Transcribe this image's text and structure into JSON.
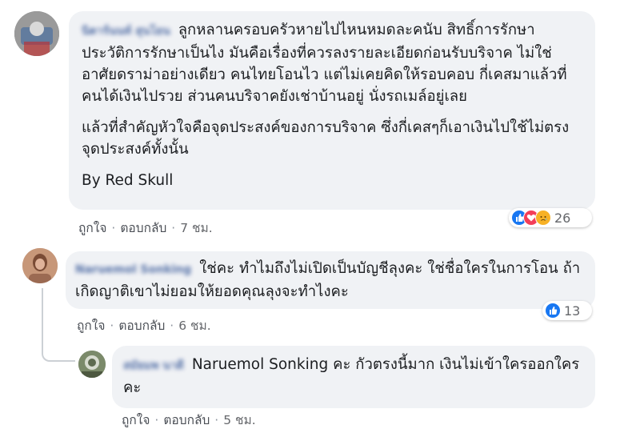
{
  "comments": [
    {
      "author": "นิตาร์นนท์ สุนโยน",
      "paragraphs": [
        "ลูกหลานครอบครัวหายไปไหนหมดละคนับ สิทธิ์การรักษา ประวัติการรักษาเป็นไง มันคือเรื่องที่ควรลงรายละเอียดก่อนรับบริจาค ไม่ใช่อาศัยดราม่าอย่างเดียว คนไทยโอนไว แต่ไม่เคยคิดให้รอบคอบ กี่เคสมาแล้วที่คนได้เงินไปรวย ส่วนคนบริจาคยังเช่าบ้านอยู่ นั่งรถเมล์อยู่เลย",
        "แล้วที่สำคัญหัวใจคือจุดประสงค์ของการบริจาค ซึ่งกี่เคสๆก็เอาเงินไปใช้ไม่ตรงจุดประสงค์ทั้งนั้น",
        "By Red Skull"
      ],
      "like_label": "ถูกใจ",
      "reply_label": "ตอบกลับ",
      "time": "7 ชม.",
      "reaction_icons": [
        "like-icon",
        "love-icon",
        "sad-icon"
      ],
      "reaction_count": "26"
    },
    {
      "author": "Naruemol Sonking",
      "paragraphs": [
        "ใช่คะ ทำไมถึงไม่เปิดเป็นบัญชีลุงคะ ใช่ชื่อใครในการโอน ถ้าเกิดญาติเขาไม่ยอมให้ยอดคุณลุงจะทำไงคะ"
      ],
      "like_label": "ถูกใจ",
      "reply_label": "ตอบกลับ",
      "time": "6 ชม.",
      "reaction_icons": [
        "like-icon"
      ],
      "reaction_count": "13"
    },
    {
      "author": "สมัยมพ นาดี",
      "paragraphs": [
        "Naruemol Sonking คะ กัวตรงนี้มาก เงินไม่เข้าใครออกใครคะ"
      ],
      "like_label": "ถูกใจ",
      "reply_label": "ตอบกลับ",
      "time": "5 ชม."
    }
  ],
  "colors": {
    "bubble": "#f0f2f5",
    "author": "#385898",
    "meta": "#65676b",
    "like": "#1877f2",
    "love": "#f33e58",
    "sad": "#f7b125"
  }
}
